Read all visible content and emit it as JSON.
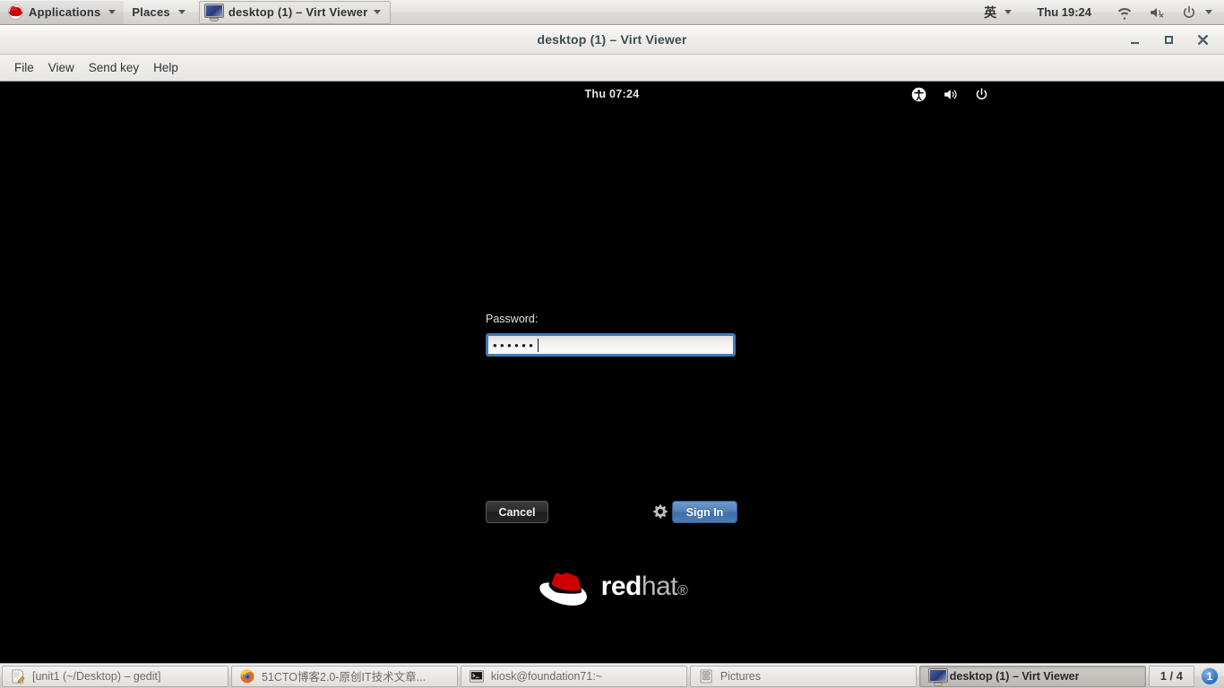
{
  "gnome_panel": {
    "applications_label": "Applications",
    "places_label": "Places",
    "window_button_label": "desktop (1) – Virt Viewer",
    "input_method": "英",
    "clock": "Thu 19:24",
    "icons": {
      "redhat": "redhat-icon",
      "monitor": "monitor-icon",
      "network": "wifi-icon",
      "volume": "volume-muted-icon",
      "power": "power-icon"
    }
  },
  "viewer_window": {
    "title": "desktop (1) – Virt Viewer",
    "controls": {
      "minimize": "–",
      "maximize": "□",
      "close": "×"
    },
    "menu": [
      {
        "label": "File"
      },
      {
        "label": "View"
      },
      {
        "label": "Send key"
      },
      {
        "label": "Help"
      }
    ]
  },
  "guest_screen": {
    "topbar": {
      "clock": "Thu 07:24",
      "icons": {
        "accessibility": "accessibility-icon",
        "volume": "volume-icon",
        "power": "power-icon"
      }
    },
    "login": {
      "password_label": "Password:",
      "password_value": "••••••",
      "password_placeholder": "",
      "cancel_label": "Cancel",
      "signin_label": "Sign In",
      "gear_icon": "session-options-gear-icon",
      "accent_color": "#4f80b8",
      "field_focus_color": "#3f7cb5"
    },
    "branding": {
      "word_red": "red",
      "word_hat": "hat",
      "trademark": "®",
      "logo_color": "#cc0000"
    }
  },
  "taskbar": {
    "tasks": [
      {
        "label": "[unit1 (~/Desktop) – gedit]",
        "icon": "gedit-icon",
        "active": false
      },
      {
        "label": "51CTO博客2.0-原创IT技术文章...",
        "icon": "firefox-icon",
        "active": false
      },
      {
        "label": "kiosk@foundation71:~",
        "icon": "terminal-icon",
        "active": false
      },
      {
        "label": "Pictures",
        "icon": "file-manager-icon",
        "active": false
      },
      {
        "label": "desktop (1) – Virt Viewer",
        "icon": "monitor-icon",
        "active": true
      }
    ],
    "workspace_indicator": "1 / 4",
    "notification_count": "1"
  }
}
